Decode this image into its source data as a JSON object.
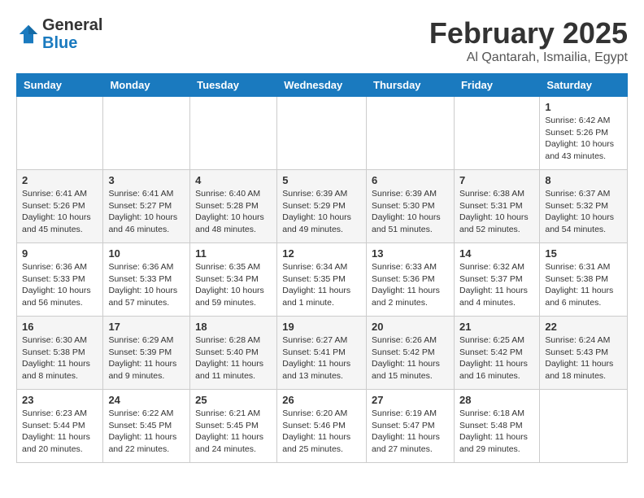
{
  "logo": {
    "general": "General",
    "blue": "Blue"
  },
  "title": {
    "month_year": "February 2025",
    "location": "Al Qantarah, Ismailia, Egypt"
  },
  "days_of_week": [
    "Sunday",
    "Monday",
    "Tuesday",
    "Wednesday",
    "Thursday",
    "Friday",
    "Saturday"
  ],
  "weeks": [
    [
      {
        "day": "",
        "info": ""
      },
      {
        "day": "",
        "info": ""
      },
      {
        "day": "",
        "info": ""
      },
      {
        "day": "",
        "info": ""
      },
      {
        "day": "",
        "info": ""
      },
      {
        "day": "",
        "info": ""
      },
      {
        "day": "1",
        "info": "Sunrise: 6:42 AM\nSunset: 5:26 PM\nDaylight: 10 hours and 43 minutes."
      }
    ],
    [
      {
        "day": "2",
        "info": "Sunrise: 6:41 AM\nSunset: 5:26 PM\nDaylight: 10 hours and 45 minutes."
      },
      {
        "day": "3",
        "info": "Sunrise: 6:41 AM\nSunset: 5:27 PM\nDaylight: 10 hours and 46 minutes."
      },
      {
        "day": "4",
        "info": "Sunrise: 6:40 AM\nSunset: 5:28 PM\nDaylight: 10 hours and 48 minutes."
      },
      {
        "day": "5",
        "info": "Sunrise: 6:39 AM\nSunset: 5:29 PM\nDaylight: 10 hours and 49 minutes."
      },
      {
        "day": "6",
        "info": "Sunrise: 6:39 AM\nSunset: 5:30 PM\nDaylight: 10 hours and 51 minutes."
      },
      {
        "day": "7",
        "info": "Sunrise: 6:38 AM\nSunset: 5:31 PM\nDaylight: 10 hours and 52 minutes."
      },
      {
        "day": "8",
        "info": "Sunrise: 6:37 AM\nSunset: 5:32 PM\nDaylight: 10 hours and 54 minutes."
      }
    ],
    [
      {
        "day": "9",
        "info": "Sunrise: 6:36 AM\nSunset: 5:33 PM\nDaylight: 10 hours and 56 minutes."
      },
      {
        "day": "10",
        "info": "Sunrise: 6:36 AM\nSunset: 5:33 PM\nDaylight: 10 hours and 57 minutes."
      },
      {
        "day": "11",
        "info": "Sunrise: 6:35 AM\nSunset: 5:34 PM\nDaylight: 10 hours and 59 minutes."
      },
      {
        "day": "12",
        "info": "Sunrise: 6:34 AM\nSunset: 5:35 PM\nDaylight: 11 hours and 1 minute."
      },
      {
        "day": "13",
        "info": "Sunrise: 6:33 AM\nSunset: 5:36 PM\nDaylight: 11 hours and 2 minutes."
      },
      {
        "day": "14",
        "info": "Sunrise: 6:32 AM\nSunset: 5:37 PM\nDaylight: 11 hours and 4 minutes."
      },
      {
        "day": "15",
        "info": "Sunrise: 6:31 AM\nSunset: 5:38 PM\nDaylight: 11 hours and 6 minutes."
      }
    ],
    [
      {
        "day": "16",
        "info": "Sunrise: 6:30 AM\nSunset: 5:38 PM\nDaylight: 11 hours and 8 minutes."
      },
      {
        "day": "17",
        "info": "Sunrise: 6:29 AM\nSunset: 5:39 PM\nDaylight: 11 hours and 9 minutes."
      },
      {
        "day": "18",
        "info": "Sunrise: 6:28 AM\nSunset: 5:40 PM\nDaylight: 11 hours and 11 minutes."
      },
      {
        "day": "19",
        "info": "Sunrise: 6:27 AM\nSunset: 5:41 PM\nDaylight: 11 hours and 13 minutes."
      },
      {
        "day": "20",
        "info": "Sunrise: 6:26 AM\nSunset: 5:42 PM\nDaylight: 11 hours and 15 minutes."
      },
      {
        "day": "21",
        "info": "Sunrise: 6:25 AM\nSunset: 5:42 PM\nDaylight: 11 hours and 16 minutes."
      },
      {
        "day": "22",
        "info": "Sunrise: 6:24 AM\nSunset: 5:43 PM\nDaylight: 11 hours and 18 minutes."
      }
    ],
    [
      {
        "day": "23",
        "info": "Sunrise: 6:23 AM\nSunset: 5:44 PM\nDaylight: 11 hours and 20 minutes."
      },
      {
        "day": "24",
        "info": "Sunrise: 6:22 AM\nSunset: 5:45 PM\nDaylight: 11 hours and 22 minutes."
      },
      {
        "day": "25",
        "info": "Sunrise: 6:21 AM\nSunset: 5:45 PM\nDaylight: 11 hours and 24 minutes."
      },
      {
        "day": "26",
        "info": "Sunrise: 6:20 AM\nSunset: 5:46 PM\nDaylight: 11 hours and 25 minutes."
      },
      {
        "day": "27",
        "info": "Sunrise: 6:19 AM\nSunset: 5:47 PM\nDaylight: 11 hours and 27 minutes."
      },
      {
        "day": "28",
        "info": "Sunrise: 6:18 AM\nSunset: 5:48 PM\nDaylight: 11 hours and 29 minutes."
      },
      {
        "day": "",
        "info": ""
      }
    ]
  ]
}
